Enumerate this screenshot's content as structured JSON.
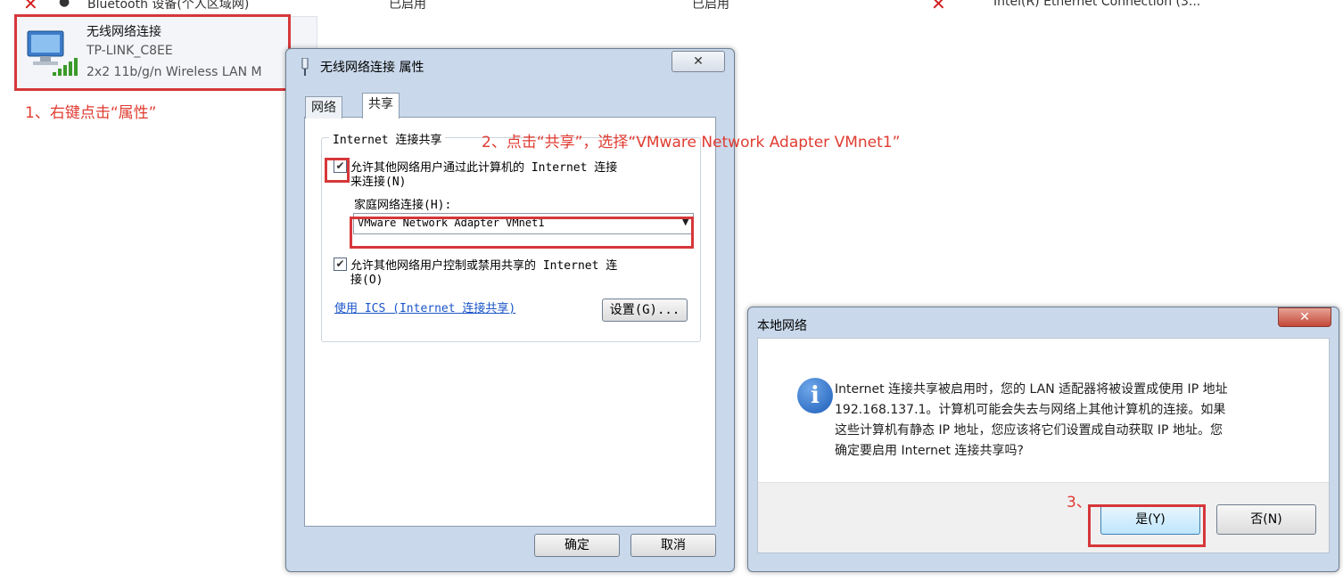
{
  "background_strip": {
    "item1": "Bluetooth 设备(个人区域网)",
    "item2": "已启用",
    "item3": "已启用",
    "item4": "Intel(R) Ethernet Connection (3..."
  },
  "network_tile": {
    "name": "无线网络连接",
    "ssid": "TP-LINK_C8EE",
    "adapter": "2x2 11b/g/n Wireless LAN M"
  },
  "annotations": {
    "step1": "1、右键点击“属性”",
    "step2": "2、点击“共享”，选择“VMware Network Adapter VMnet1”",
    "step3": "3、"
  },
  "properties_dialog": {
    "title": "无线网络连接 属性",
    "close": "✕",
    "tabs": [
      "网络",
      "共享"
    ],
    "group_title": "Internet 连接共享",
    "allow_connect_line1": "允许其他网络用户通过此计算机的 Internet 连接",
    "allow_connect_line2": "来连接(N)",
    "home_label": "家庭网络连接(H):",
    "home_value": "VMware Network Adapter VMnet1",
    "allow_control_line1": "允许其他网络用户控制或禁用共享的 Internet 连",
    "allow_control_line2": "接(O)",
    "ics_link": "使用 ICS (Internet 连接共享)",
    "settings_button": "设置(G)...",
    "ok_button": "确定",
    "cancel_button": "取消"
  },
  "message_box": {
    "title": "本地网络",
    "close": "✕",
    "lines": [
      "Internet 连接共享被启用时，您的 LAN 适配器将被设置成使用 IP 地址",
      "192.168.137.1。计算机可能会失去与网络上其他计算机的连接。如果",
      "这些计算机有静态 IP 地址，您应该将它们设置成自动获取 IP 地址。您",
      "确定要启用 Internet 连接共享吗?"
    ],
    "yes_button": "是(Y)",
    "no_button": "否(N)"
  },
  "colors": {
    "annotation": "#e03c31",
    "dialog_frame": "#c9d8ea"
  }
}
